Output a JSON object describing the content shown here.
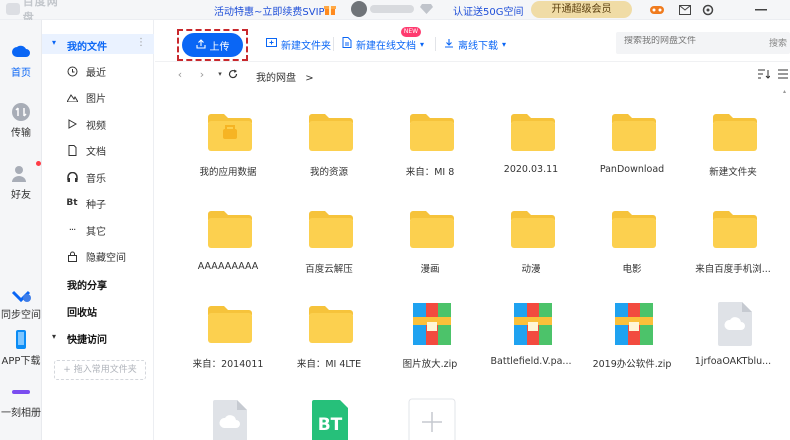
{
  "app": {
    "logo_text": "百度网盘"
  },
  "topbar": {
    "promo": "活动特惠~立即续费SVIP",
    "verify": "认证送50G空间",
    "vip_button": "开通超级会员",
    "icons": [
      "gift-icon",
      "diamond-icon",
      "game-icon",
      "mail-icon",
      "settings-icon",
      "minimize-icon"
    ]
  },
  "rail": {
    "items": [
      {
        "label": "首页",
        "icon": "home-icon"
      },
      {
        "label": "传输",
        "icon": "transfer-icon"
      },
      {
        "label": "好友",
        "icon": "friends-icon"
      },
      {
        "label": "同步空间",
        "icon": "sync-icon"
      },
      {
        "label": "APP下载",
        "icon": "phone-icon"
      },
      {
        "label": "一刻相册",
        "icon": "album-icon"
      }
    ]
  },
  "side": {
    "my_files": "我的文件",
    "categories": [
      {
        "label": "最近",
        "icon": "clock-icon"
      },
      {
        "label": "图片",
        "icon": "image-icon"
      },
      {
        "label": "视频",
        "icon": "video-icon"
      },
      {
        "label": "文档",
        "icon": "document-icon"
      },
      {
        "label": "音乐",
        "icon": "headphone-icon"
      },
      {
        "label": "种子",
        "icon": "bt-icon",
        "glyph": "Bt"
      },
      {
        "label": "其它",
        "icon": "more-icon"
      },
      {
        "label": "隐藏空间",
        "icon": "lock-icon"
      }
    ],
    "my_share": "我的分享",
    "recycle": "回收站",
    "quick_access": "快捷访问",
    "add_common": "+ 拖入常用文件夹"
  },
  "toolbar": {
    "upload": "上传",
    "new_folder": "新建文件夹",
    "new_online_doc": "新建在线文档",
    "new_badge": "NEW",
    "offline_download": "离线下载",
    "search_placeholder": "搜索我的网盘文件",
    "search_button": "搜索"
  },
  "nav": {
    "breadcrumb": "我的网盘",
    "crumb_sep": ">"
  },
  "files": [
    {
      "name": "我的应用数据",
      "type": "app-folder"
    },
    {
      "name": "我的资源",
      "type": "folder"
    },
    {
      "name": "来自：MI 8",
      "type": "folder"
    },
    {
      "name": "2020.03.11",
      "type": "folder"
    },
    {
      "name": "PanDownload",
      "type": "folder"
    },
    {
      "name": "新建文件夹",
      "type": "folder"
    },
    {
      "name": "AAAAAAAAA",
      "type": "folder"
    },
    {
      "name": "百度云解压",
      "type": "folder"
    },
    {
      "name": "漫画",
      "type": "folder"
    },
    {
      "name": "动漫",
      "type": "folder"
    },
    {
      "name": "电影",
      "type": "folder"
    },
    {
      "name": "来自百度手机浏...",
      "type": "folder"
    },
    {
      "name": "来自：2014011",
      "type": "folder"
    },
    {
      "name": "来自：MI 4LTE",
      "type": "folder"
    },
    {
      "name": "图片放大.zip",
      "type": "zip"
    },
    {
      "name": "Battlefield.V.pa...",
      "type": "zip"
    },
    {
      "name": "2019办公软件.zip",
      "type": "zip"
    },
    {
      "name": "1jrfoaOAKTblu...",
      "type": "cloud"
    },
    {
      "name": "",
      "type": "cloud"
    },
    {
      "name": "",
      "type": "bt",
      "glyph": "BT"
    },
    {
      "name": "",
      "type": "add"
    }
  ],
  "colors": {
    "accent": "#0a66f5",
    "folder": "#fcd04f",
    "folder_tab": "#f6c33b",
    "highlight": "#c8282d"
  }
}
